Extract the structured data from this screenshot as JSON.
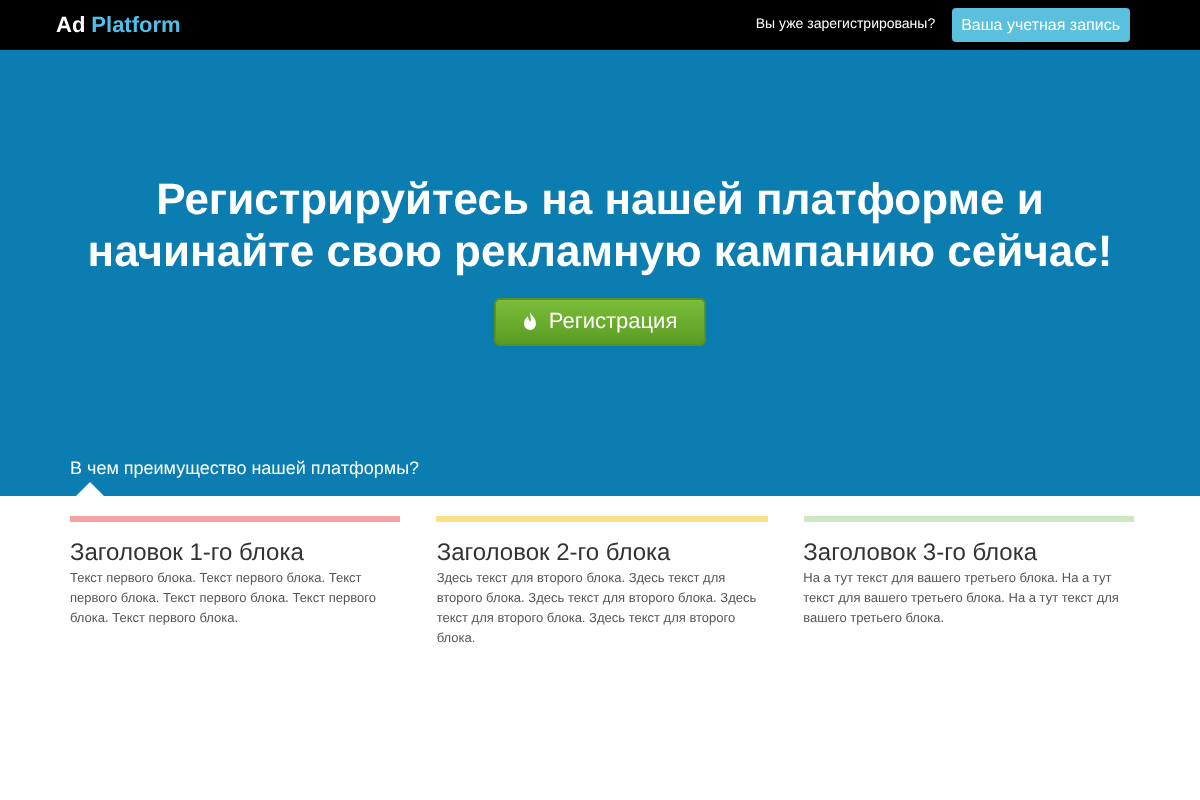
{
  "navbar": {
    "brand": {
      "first": "Ad",
      "second": "Platform"
    },
    "question": "Вы уже зарегистрированы?",
    "account_button": "Ваша учетная запись"
  },
  "hero": {
    "headline": "Регистрируйтесь на нашей платформе и начинайте свою рекламную кампанию сейчас!",
    "register_button": "Регистрация",
    "subheading": "В чем преимущество нашей платформы?"
  },
  "blocks": [
    {
      "title": "Заголовок 1-го блока",
      "text": "Текст первого блока. Текст первого блока. Текст первого блока. Текст первого блока. Текст первого блока. Текст первого блока.",
      "color": "#f4a3a3"
    },
    {
      "title": "Заголовок 2-го блока",
      "text": "Здесь текст для второго блока. Здесь текст для второго блока. Здесь текст для второго блока. Здесь текст для второго блока. Здесь текст для второго блока.",
      "color": "#fbe08a"
    },
    {
      "title": "Заголовок 3-го блока",
      "text": "На а тут текст для вашего третьего блока. На а тут текст для вашего третьего блока. На а тут текст для вашего третьего блока.",
      "color": "#cfe8c4"
    }
  ]
}
